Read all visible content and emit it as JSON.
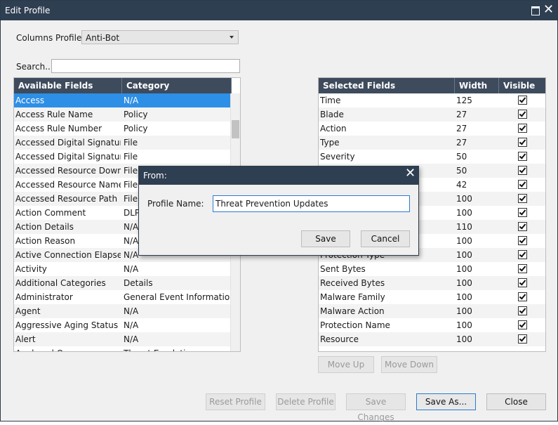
{
  "window": {
    "title": "Edit Profile"
  },
  "columns_profile": {
    "label": "Columns Profile:",
    "value": "Anti-Bot"
  },
  "search": {
    "label": "Search...",
    "value": ""
  },
  "available": {
    "headers": [
      "Available Fields",
      "Category"
    ],
    "rows": [
      [
        "Access",
        "N/A"
      ],
      [
        "Access Rule Name",
        "Policy"
      ],
      [
        "Access Rule Number",
        "Policy"
      ],
      [
        "Accessed Digital Signature A",
        "File"
      ],
      [
        "Accessed Digital Signature C",
        "File"
      ],
      [
        "Accessed Resource Downloa",
        "File"
      ],
      [
        "Accessed Resource Name",
        "File"
      ],
      [
        "Accessed Resource Path",
        "File"
      ],
      [
        "Action Comment",
        "DLP"
      ],
      [
        "Action Details",
        "N/A"
      ],
      [
        "Action Reason",
        "N/A"
      ],
      [
        "Active Connection Elapsed",
        "N/A"
      ],
      [
        "Activity",
        "N/A"
      ],
      [
        "Additional Categories",
        "Details"
      ],
      [
        "Administrator",
        "General Event Information"
      ],
      [
        "Agent",
        "N/A"
      ],
      [
        "Aggressive Aging Status",
        "N/A"
      ],
      [
        "Alert",
        "N/A"
      ],
      [
        "Analyzed On",
        "Threat Emulation"
      ]
    ]
  },
  "selected": {
    "headers": [
      "Selected Fields",
      "Width",
      "Visible"
    ],
    "rows": [
      [
        "Time",
        "125"
      ],
      [
        "Blade",
        "27"
      ],
      [
        "Action",
        "27"
      ],
      [
        "Type",
        "27"
      ],
      [
        "Severity",
        "50"
      ],
      [
        "",
        "50"
      ],
      [
        "",
        "42"
      ],
      [
        "",
        "100"
      ],
      [
        "",
        "100"
      ],
      [
        "",
        "110"
      ],
      [
        "",
        "100"
      ],
      [
        "Protection Type",
        "100"
      ],
      [
        "Sent Bytes",
        "100"
      ],
      [
        "Received Bytes",
        "100"
      ],
      [
        "Malware Family",
        "100"
      ],
      [
        "Malware Action",
        "100"
      ],
      [
        "Protection Name",
        "100"
      ],
      [
        "Resource",
        "100"
      ]
    ]
  },
  "buttons": {
    "move_up": "Move Up",
    "move_down": "Move Down",
    "reset_profile": "Reset Profile",
    "delete_profile": "Delete Profile",
    "save_changes": "Save Changes",
    "save_as": "Save As...",
    "close": "Close"
  },
  "dialog": {
    "title": "From:",
    "profile_name_label": "Profile Name:",
    "profile_name_value": "Threat Prevention Updates",
    "save": "Save",
    "cancel": "Cancel"
  },
  "colors": {
    "titlebar": "#2f3f52",
    "header": "#3d4b5c",
    "selection": "#2e8fe6"
  }
}
